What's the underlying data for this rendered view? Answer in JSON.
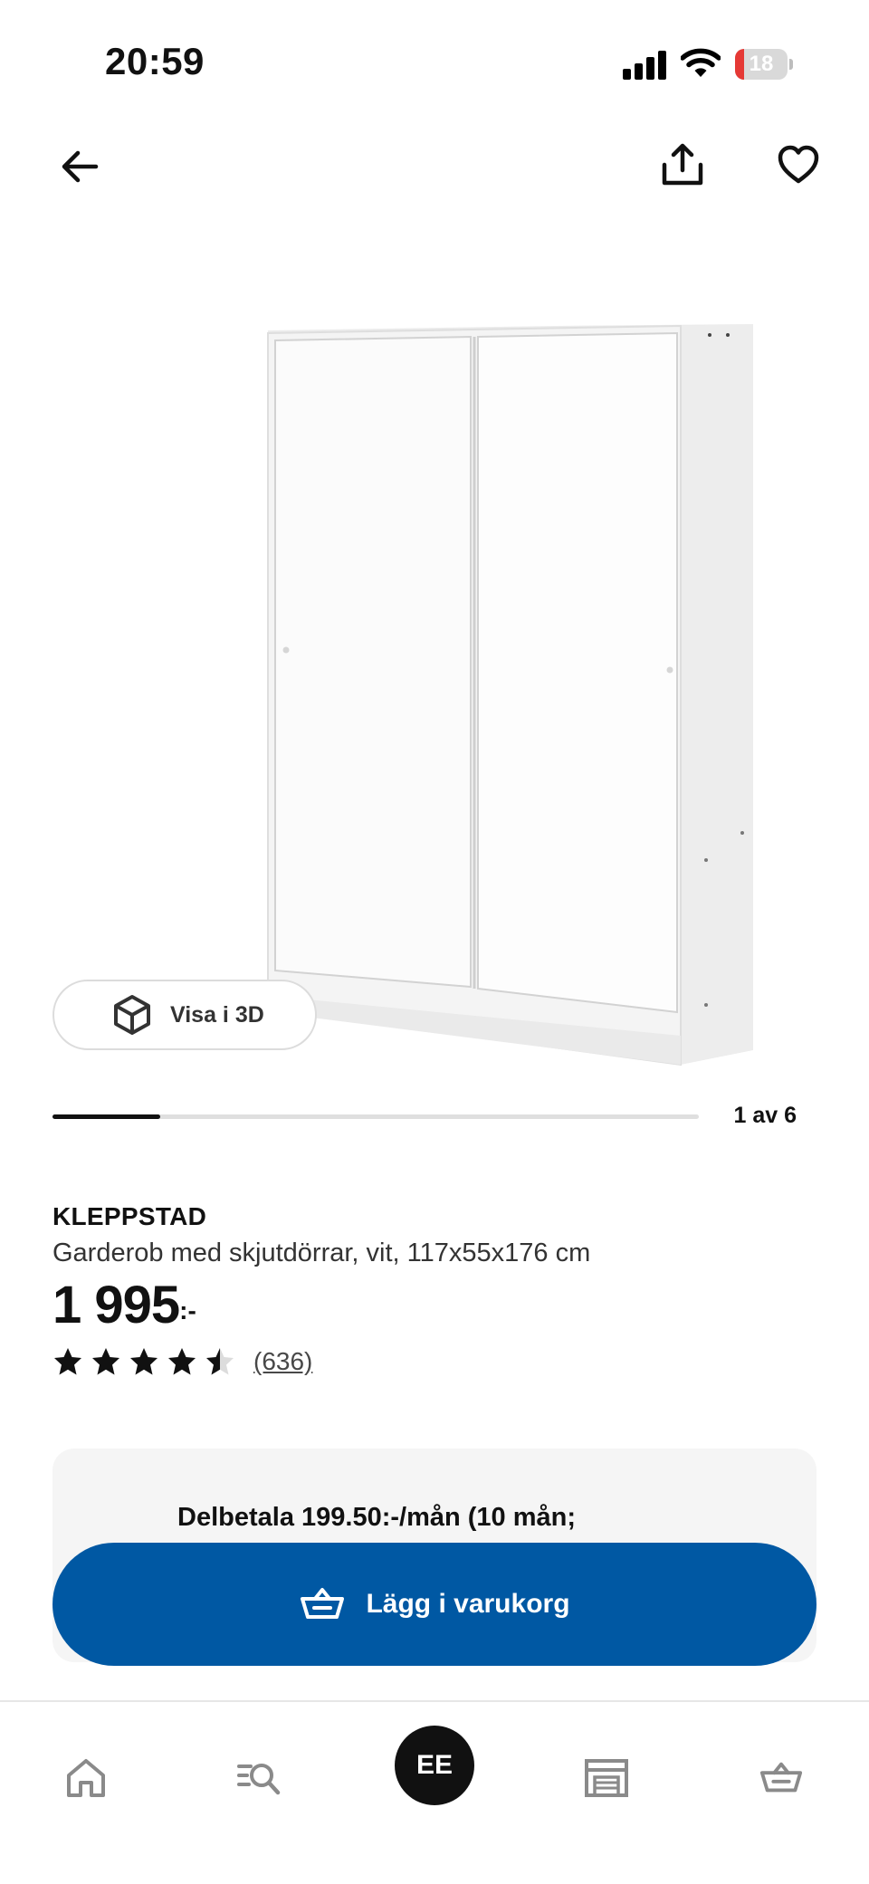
{
  "status_bar": {
    "time": "20:59",
    "battery_level": "18",
    "battery_fraction": 0.18,
    "battery_color": "#e53935"
  },
  "top_nav": {
    "back_icon": "arrow-left-icon",
    "share_icon": "share-icon",
    "favorite_icon": "heart-icon"
  },
  "media": {
    "view_3d_label": "Visa i 3D",
    "view_3d_icon": "cube-icon",
    "carousel_position": "1 av 6",
    "carousel_current": 1,
    "carousel_total": 6
  },
  "product": {
    "name": "KLEPPSTAD",
    "description": "Garderob med skjutdörrar, vit, 117x55x176 cm",
    "price": "1 995",
    "price_suffix": ":-",
    "rating_value": 4.5,
    "rating_max": 5,
    "rating_count": "(636)"
  },
  "installment": {
    "text": "Delbetala 199.50:-/mån (10 mån;"
  },
  "cart_button": {
    "label": "Lägg i varukorg",
    "icon": "basket-icon",
    "color": "#0058a3"
  },
  "tabbar": {
    "home_icon": "home-icon",
    "search_icon": "search-list-icon",
    "profile_initials": "EE",
    "store_icon": "store-icon",
    "cart_icon": "basket-icon"
  }
}
